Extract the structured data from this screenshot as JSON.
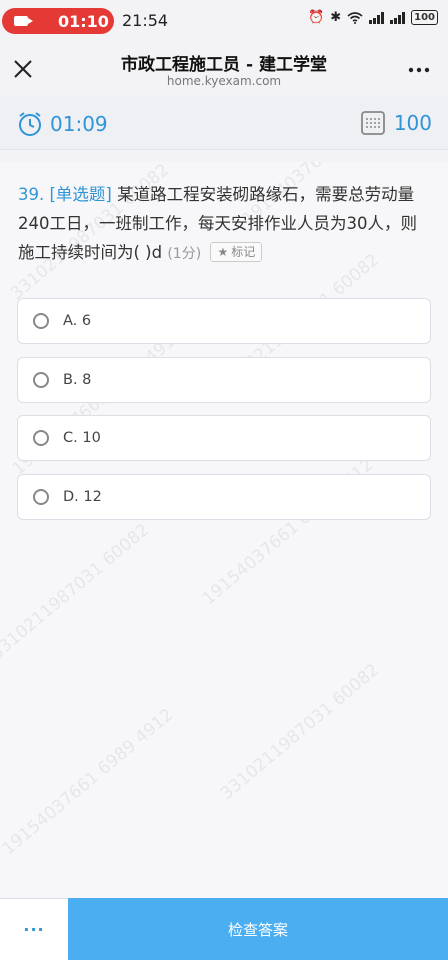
{
  "status_bar": {
    "recording_time": "01:10",
    "clock": "21:54",
    "battery": "100"
  },
  "header": {
    "title": "市政工程施工员 - 建工学堂",
    "url": "home.kyexam.com"
  },
  "exam": {
    "timer": "01:09",
    "score": "100"
  },
  "question": {
    "number": "39.",
    "type": "[单选题]",
    "text": "某道路工程安装砌路缘石，需要总劳动量240工日，一班制工作，每天安排作业人员为30人，则施工持续时间为( )d",
    "points": "(1分)",
    "mark_label": "标记"
  },
  "options": [
    {
      "label": "A. 6"
    },
    {
      "label": "B. 8"
    },
    {
      "label": "C. 10"
    },
    {
      "label": "D. 12"
    }
  ],
  "watermark": {
    "line1": "19154037661 6989 4912",
    "line2": "3310211987031 60082"
  },
  "bottom": {
    "more_label": "···",
    "check_answer_label": "检查答案"
  },
  "colors": {
    "accent": "#2f95d8",
    "button": "#4aaef0",
    "record": "#e53935"
  }
}
